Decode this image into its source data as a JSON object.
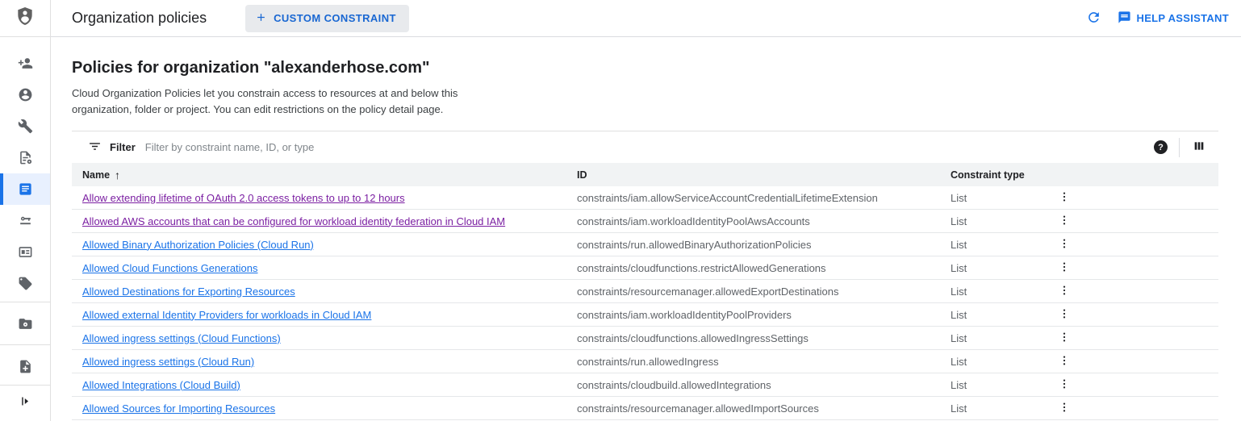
{
  "header": {
    "title": "Organization policies",
    "custom_constraint_label": "CUSTOM CONSTRAINT",
    "help_assistant_label": "HELP ASSISTANT"
  },
  "sidebar": {
    "logo_icon": "shield-person-icon",
    "items": [
      {
        "icon": "add-person-icon",
        "active": false
      },
      {
        "icon": "identity-person-icon",
        "active": false
      },
      {
        "icon": "wrench-icon",
        "active": false
      },
      {
        "icon": "document-gear-icon",
        "active": false
      },
      {
        "icon": "policy-list-icon",
        "active": true
      },
      {
        "icon": "key-card-icon",
        "active": false
      },
      {
        "icon": "id-card-icon",
        "active": false
      },
      {
        "icon": "tag-icon",
        "active": false
      },
      {
        "icon": "folder-gear-icon",
        "active": false
      },
      {
        "icon": "note-add-icon",
        "active": false
      }
    ],
    "collapse_icon": "collapse-sidebar-icon"
  },
  "content": {
    "heading": "Policies for organization \"alexanderhose.com\"",
    "description_lines": [
      "Cloud Organization Policies let you constrain access to resources at and below this",
      "organization, folder or project. You can edit restrictions on the policy detail page."
    ]
  },
  "filter": {
    "label": "Filter",
    "placeholder": "Filter by constraint name, ID, or type",
    "help_icon": "?",
    "icons": [
      "filter-list-icon",
      "help-circle-icon",
      "column-display-icon"
    ]
  },
  "table": {
    "columns": [
      "Name",
      "ID",
      "Constraint type"
    ],
    "sort": {
      "column": "Name",
      "direction": "ascending",
      "arrow": "↑"
    },
    "rows": [
      {
        "name": "Allow extending lifetime of OAuth 2.0 access tokens to up to 12 hours",
        "id": "constraints/iam.allowServiceAccountCredentialLifetimeExtension",
        "constraint_type": "List",
        "visited": true
      },
      {
        "name": "Allowed AWS accounts that can be configured for workload identity federation in Cloud IAM",
        "id": "constraints/iam.workloadIdentityPoolAwsAccounts",
        "constraint_type": "List",
        "visited": true
      },
      {
        "name": "Allowed Binary Authorization Policies (Cloud Run)",
        "id": "constraints/run.allowedBinaryAuthorizationPolicies",
        "constraint_type": "List",
        "visited": false
      },
      {
        "name": "Allowed Cloud Functions Generations",
        "id": "constraints/cloudfunctions.restrictAllowedGenerations",
        "constraint_type": "List",
        "visited": false
      },
      {
        "name": "Allowed Destinations for Exporting Resources",
        "id": "constraints/resourcemanager.allowedExportDestinations",
        "constraint_type": "List",
        "visited": false
      },
      {
        "name": "Allowed external Identity Providers for workloads in Cloud IAM",
        "id": "constraints/iam.workloadIdentityPoolProviders",
        "constraint_type": "List",
        "visited": false
      },
      {
        "name": "Allowed ingress settings (Cloud Functions)",
        "id": "constraints/cloudfunctions.allowedIngressSettings",
        "constraint_type": "List",
        "visited": false
      },
      {
        "name": "Allowed ingress settings (Cloud Run)",
        "id": "constraints/run.allowedIngress",
        "constraint_type": "List",
        "visited": false
      },
      {
        "name": "Allowed Integrations (Cloud Build)",
        "id": "constraints/cloudbuild.allowedIntegrations",
        "constraint_type": "List",
        "visited": false
      },
      {
        "name": "Allowed Sources for Importing Resources",
        "id": "constraints/resourcemanager.allowedImportSources",
        "constraint_type": "List",
        "visited": false
      }
    ]
  },
  "colors": {
    "link_blue": "#1a73e8",
    "visited_purple": "#7b1fa2",
    "button_blue": "#1967d2",
    "active_nav_bg": "#e8f0fe",
    "table_header_bg": "#f1f3f4",
    "secondary_text": "#5f6368"
  }
}
